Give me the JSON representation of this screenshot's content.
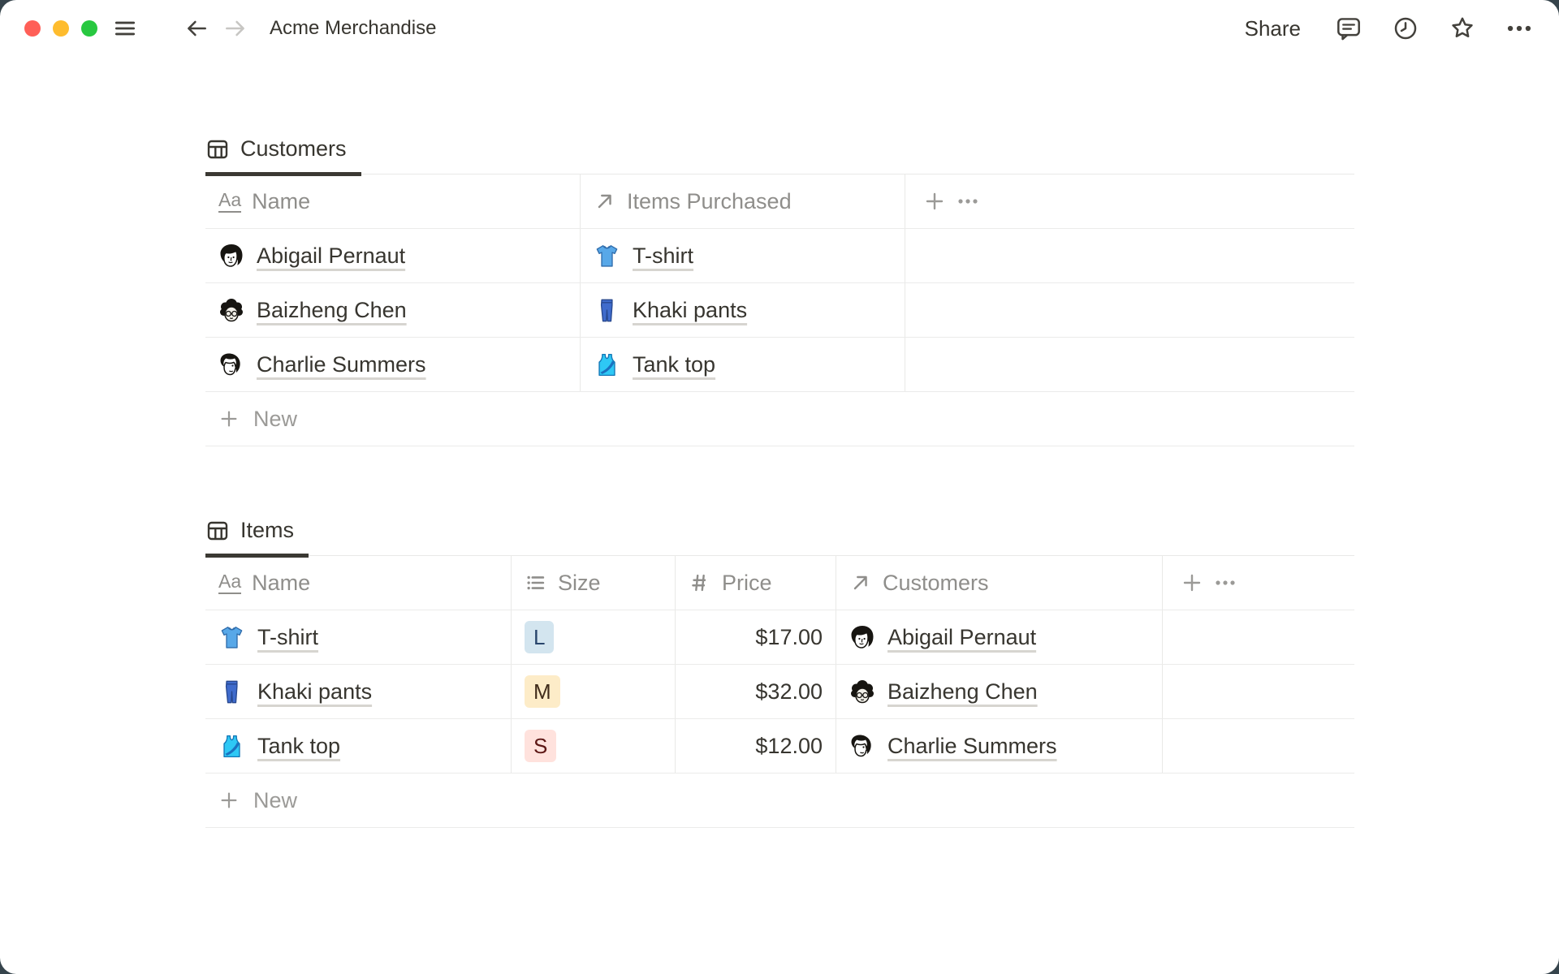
{
  "window_chrome": {
    "background_behind_window": "#36444c",
    "traffic_lights": {
      "close": "#ff5f57",
      "minimize": "#febc2e",
      "zoom": "#28c840"
    }
  },
  "topbar": {
    "title": "Acme Merchandise",
    "share_label": "Share",
    "icons": [
      "hamburger-menu-icon",
      "back-arrow-icon",
      "forward-arrow-icon",
      "comment-icon",
      "clock-history-icon",
      "star-favorite-icon",
      "ellipsis-more-icon"
    ]
  },
  "customers_table": {
    "tab_label": "Customers",
    "tab_icon": "table-view-icon",
    "columns": {
      "name": {
        "label": "Name",
        "icon": "text-Aa-icon"
      },
      "items_purchased": {
        "label": "Items Purchased",
        "icon": "relation-arrow-icon"
      }
    },
    "header_buttons": [
      "add-property-plus-icon",
      "more-options-dots-icon"
    ],
    "rows": [
      {
        "name": "Abigail Pernaut",
        "avatar": "woman-bob-haircut-illustration",
        "item": "T-shirt",
        "item_icon": "blue-tshirt"
      },
      {
        "name": "Baizheng Chen",
        "avatar": "curly-hair-glasses-illustration",
        "item": "Khaki pants",
        "item_icon": "blue-jeans"
      },
      {
        "name": "Charlie Summers",
        "avatar": "profile-face-illustration",
        "item": "Tank top",
        "item_icon": "cyan-tank-top"
      }
    ],
    "new_label": "New"
  },
  "items_table": {
    "tab_label": "Items",
    "tab_icon": "table-view-icon",
    "columns": {
      "name": {
        "label": "Name",
        "icon": "text-Aa-icon"
      },
      "size": {
        "label": "Size",
        "icon": "select-list-icon"
      },
      "price": {
        "label": "Price",
        "icon": "number-hash-icon"
      },
      "customers": {
        "label": "Customers",
        "icon": "relation-arrow-icon"
      }
    },
    "header_buttons": [
      "add-property-plus-icon",
      "more-options-dots-icon"
    ],
    "rows": [
      {
        "name": "T-shirt",
        "icon": "blue-tshirt",
        "size": "L",
        "size_color": {
          "bg": "#d3e5ef",
          "fg": "#28456c"
        },
        "price": "$17.00",
        "customer": "Abigail Pernaut"
      },
      {
        "name": "Khaki pants",
        "icon": "blue-jeans",
        "size": "M",
        "size_color": {
          "bg": "#fdecc8",
          "fg": "#402c1b"
        },
        "price": "$32.00",
        "customer": "Baizheng Chen"
      },
      {
        "name": "Tank top",
        "icon": "cyan-tank-top",
        "size": "S",
        "size_color": {
          "bg": "#ffe2dd",
          "fg": "#5d1715"
        },
        "price": "$12.00",
        "customer": "Charlie Summers"
      }
    ],
    "new_label": "New"
  }
}
